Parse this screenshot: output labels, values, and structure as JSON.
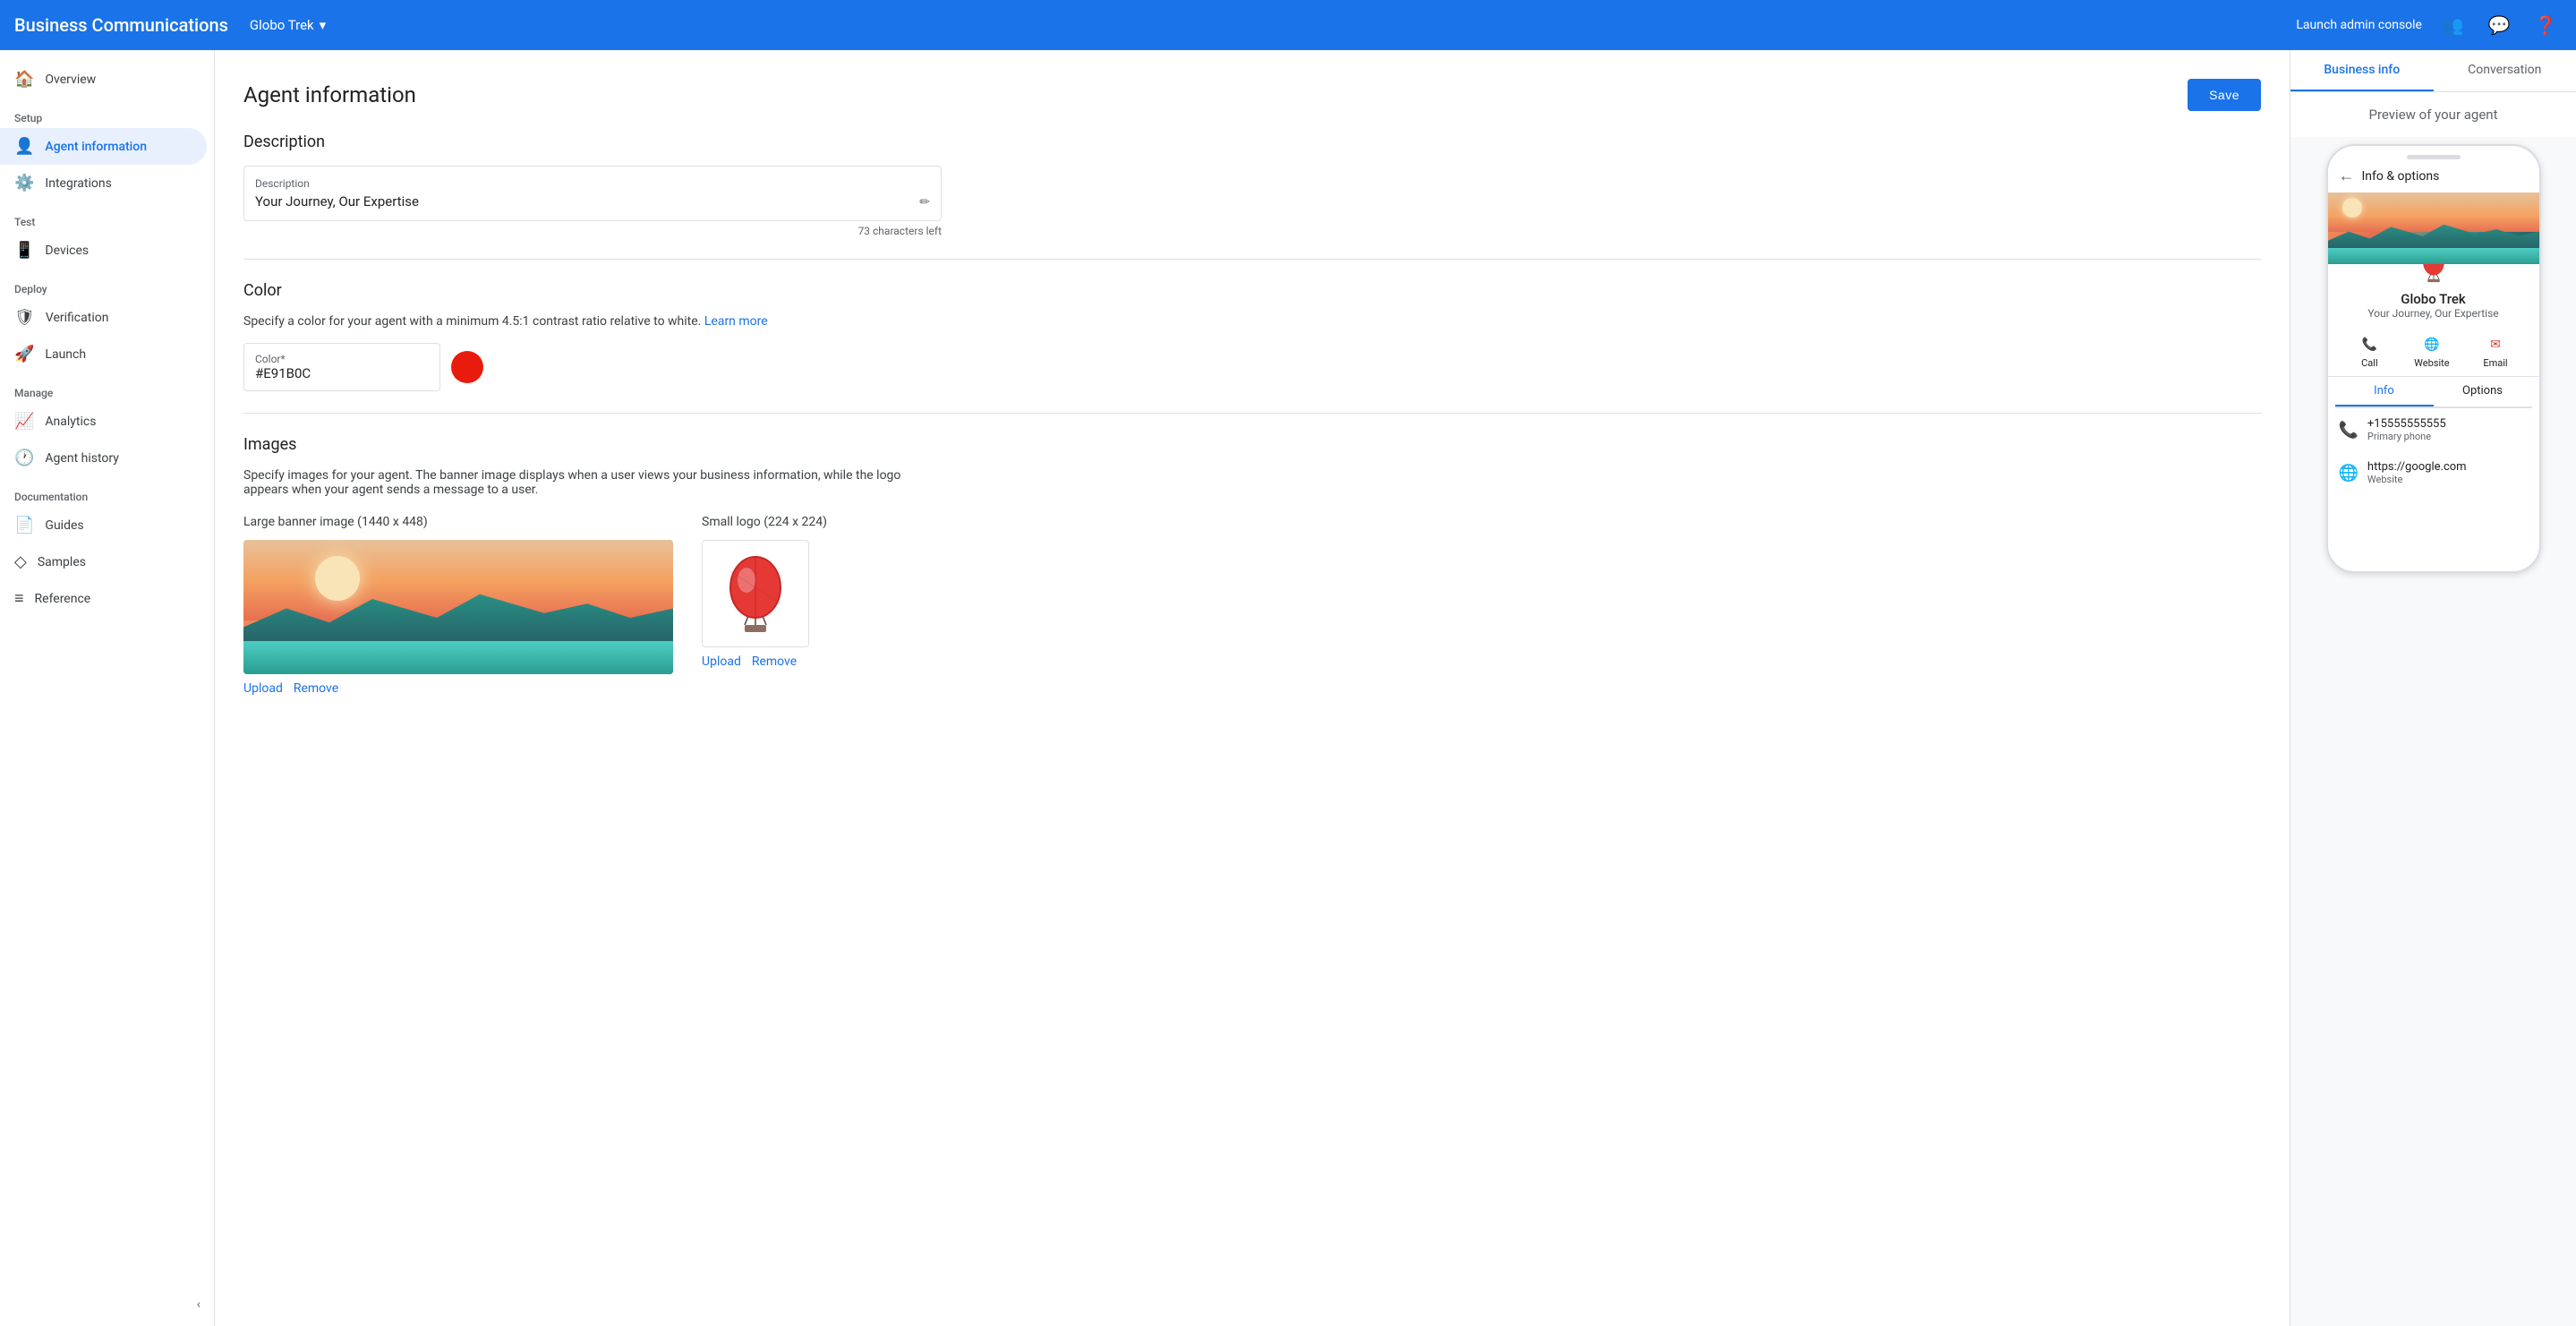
{
  "app": {
    "title": "Business Communications",
    "brand": "Globo Trek",
    "brand_arrow": "▾",
    "launch_admin": "Launch admin console",
    "save_label": "Save"
  },
  "sidebar": {
    "setup_label": "Setup",
    "test_label": "Test",
    "deploy_label": "Deploy",
    "manage_label": "Manage",
    "documentation_label": "Documentation",
    "items": [
      {
        "id": "overview",
        "label": "Overview",
        "icon": "⌂"
      },
      {
        "id": "agent-information",
        "label": "Agent information",
        "icon": "👤",
        "active": true
      },
      {
        "id": "integrations",
        "label": "Integrations",
        "icon": "⚙"
      },
      {
        "id": "devices",
        "label": "Devices",
        "icon": "📱"
      },
      {
        "id": "verification",
        "label": "Verification",
        "icon": "🛡"
      },
      {
        "id": "launch",
        "label": "Launch",
        "icon": "🚀"
      },
      {
        "id": "analytics",
        "label": "Analytics",
        "icon": "📈"
      },
      {
        "id": "agent-history",
        "label": "Agent history",
        "icon": "🕐"
      },
      {
        "id": "guides",
        "label": "Guides",
        "icon": "📄"
      },
      {
        "id": "samples",
        "label": "Samples",
        "icon": "◇"
      },
      {
        "id": "reference",
        "label": "Reference",
        "icon": "≡"
      }
    ]
  },
  "main": {
    "page_title": "Agent information",
    "sections": {
      "description": {
        "title": "Description",
        "field_label": "Description",
        "field_value": "Your Journey, Our Expertise",
        "chars_left": "73 characters left"
      },
      "color": {
        "title": "Color",
        "note": "Specify a color for your agent with a minimum 4.5:1 contrast ratio relative to white.",
        "learn_more": "Learn more",
        "field_label": "Color*",
        "field_value": "#E91B0C",
        "swatch_color": "#E91B0C"
      },
      "images": {
        "title": "Images",
        "description": "Specify images for your agent. The banner image displays when a user views your business information, while the logo appears when your agent sends a message to a user.",
        "banner_label": "Large banner image (1440 x 448)",
        "logo_label": "Small logo (224 x 224)",
        "upload_label": "Upload",
        "remove_label": "Remove"
      }
    }
  },
  "right_panel": {
    "tabs": [
      {
        "id": "business-info",
        "label": "Business info",
        "active": true
      },
      {
        "id": "conversation",
        "label": "Conversation"
      }
    ],
    "preview_title": "Preview of your agent",
    "phone": {
      "top_bar": "Info & options",
      "agent_name": "Globo Trek",
      "agent_desc": "Your Journey, Our Expertise",
      "actions": [
        {
          "id": "call",
          "label": "Call",
          "icon": "📞"
        },
        {
          "id": "website",
          "label": "Website",
          "icon": "🌐"
        },
        {
          "id": "email",
          "label": "Email",
          "icon": "✉"
        }
      ],
      "info_tabs": [
        {
          "id": "info",
          "label": "Info",
          "active": true
        },
        {
          "id": "options",
          "label": "Options"
        }
      ],
      "info_items": [
        {
          "icon": "📞",
          "primary": "+15555555555",
          "secondary": "Primary phone"
        },
        {
          "icon": "🌐",
          "primary": "https://google.com",
          "secondary": "Website"
        }
      ]
    }
  }
}
